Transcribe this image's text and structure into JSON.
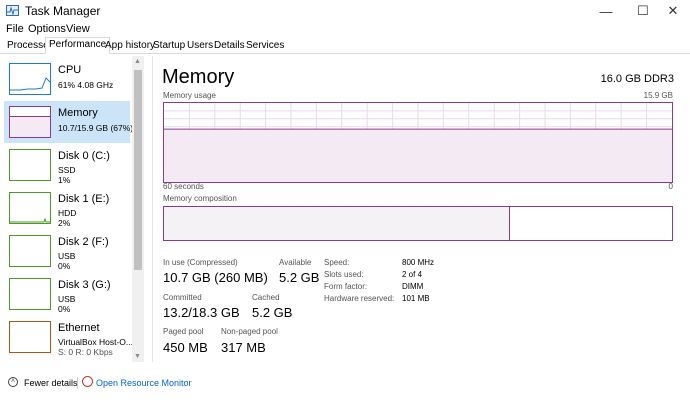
{
  "window": {
    "title": "Task Manager",
    "minimize": "—",
    "maximize": "☐",
    "close": "✕"
  },
  "menu": [
    "File",
    "Options",
    "View"
  ],
  "tabs": [
    "Processes",
    "Performance",
    "App history",
    "Startup",
    "Users",
    "Details",
    "Services"
  ],
  "active_tab": "Performance",
  "sidebar": [
    {
      "name": "CPU",
      "sub1": "61%  4.08 GHz",
      "sub2": "",
      "color": "#1f7ec2"
    },
    {
      "name": "Memory",
      "sub1": "10.7/15.9 GB (67%)",
      "sub2": "",
      "color": "#8b3a8b",
      "fill": 0.67
    },
    {
      "name": "Disk 0 (C:)",
      "sub1": "SSD",
      "sub2": "1%",
      "color": "#4d9a2a"
    },
    {
      "name": "Disk 1 (E:)",
      "sub1": "HDD",
      "sub2": "2%",
      "color": "#4d9a2a"
    },
    {
      "name": "Disk 2 (F:)",
      "sub1": "USB",
      "sub2": "0%",
      "color": "#4d9a2a"
    },
    {
      "name": "Disk 3 (G:)",
      "sub1": "USB",
      "sub2": "0%",
      "color": "#4d9a2a"
    },
    {
      "name": "Ethernet",
      "sub1": "VirtualBox Host-O...",
      "sub2": "S: 0 R: 0 Kbps",
      "color": "#a35a1a"
    }
  ],
  "main": {
    "title": "Memory",
    "spec": "16.0 GB DDR3",
    "usage_label": "Memory usage",
    "usage_max": "15.9 GB",
    "axis_left": "60 seconds",
    "axis_right": "0",
    "usage_fraction": 0.67,
    "composition_label": "Memory composition",
    "composition_in_use_fraction": 0.68,
    "stats": {
      "in_use_label": "In use (Compressed)",
      "in_use": "10.7 GB (260 MB)",
      "available_label": "Available",
      "available": "5.2 GB",
      "committed_label": "Committed",
      "committed": "13.2/18.3 GB",
      "cached_label": "Cached",
      "cached": "5.2 GB",
      "paged_label": "Paged pool",
      "paged": "450 MB",
      "nonpaged_label": "Non-paged pool",
      "nonpaged": "317 MB"
    },
    "details": [
      {
        "key": "Speed:",
        "value": "800 MHz"
      },
      {
        "key": "Slots used:",
        "value": "2 of 4"
      },
      {
        "key": "Form factor:",
        "value": "DIMM"
      },
      {
        "key": "Hardware reserved:",
        "value": "101 MB"
      }
    ]
  },
  "footer": {
    "fewer": "Fewer details",
    "monitor": "Open Resource Monitor"
  },
  "colors": {
    "memory": "#8b3a8b",
    "selection": "#cce4f7",
    "link": "#0066cc"
  }
}
